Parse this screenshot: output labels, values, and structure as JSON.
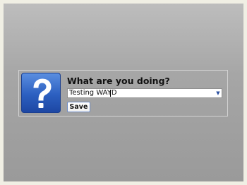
{
  "dialog": {
    "prompt": "What are you doing?",
    "icon": "question-mark-icon",
    "input_value": "Testing WAYD",
    "dropdown_icon": "chevron-down-icon",
    "save_label": "Save"
  },
  "colors": {
    "background_top": "#bdbdbd",
    "background_bottom": "#9a9a9a",
    "icon_blue": "#2c5fc0",
    "outer_border": "#f0efe4"
  }
}
